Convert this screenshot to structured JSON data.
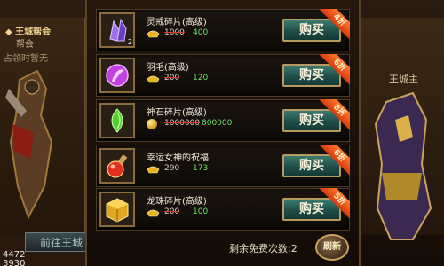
{
  "left_panel": {
    "title": "◆ 王城帮会",
    "line1": "帮会",
    "line2": "占领时暂无",
    "goto_label": "前往王城",
    "numbers": [
      "4472",
      "3930"
    ]
  },
  "right_panel": {
    "title": "王城主"
  },
  "shop": {
    "items": [
      {
        "name": "灵戒碎片(高级)",
        "qty": "2",
        "currency": "ingot",
        "old_price": "1000",
        "new_price": "400",
        "discount": "4折",
        "buy_label": "购买",
        "icon": "crystal-icon",
        "icon_color": "#8a5ad8"
      },
      {
        "name": "羽毛(高级)",
        "qty": "",
        "currency": "ingot",
        "old_price": "200",
        "new_price": "120",
        "discount": "6折",
        "buy_label": "购买",
        "icon": "feather-orb-icon",
        "icon_color": "#c040e0"
      },
      {
        "name": "神石碎片(高级)",
        "qty": "",
        "currency": "coin",
        "old_price": "1000000",
        "new_price": "800000",
        "discount": "8折",
        "buy_label": "购买",
        "icon": "green-gem-icon",
        "icon_color": "#4fcf30"
      },
      {
        "name": "幸运女神的祝福",
        "qty": "",
        "currency": "ingot",
        "old_price": "290",
        "new_price": "173",
        "discount": "6折",
        "buy_label": "购买",
        "icon": "potion-icon",
        "icon_color": "#e03020"
      },
      {
        "name": "龙珠碎片(高级)",
        "qty": "",
        "currency": "ingot",
        "old_price": "200",
        "new_price": "100",
        "discount": "5折",
        "buy_label": "购买",
        "icon": "gold-cube-icon",
        "icon_color": "#e0a820"
      }
    ]
  },
  "footer": {
    "free_refresh_label": "剩余免费次数:2",
    "refresh_label": "刷新"
  },
  "colors": {
    "discount_ribbon": "#e8561c",
    "buy_button": "#2a5f57",
    "new_price": "#6ee06e"
  }
}
